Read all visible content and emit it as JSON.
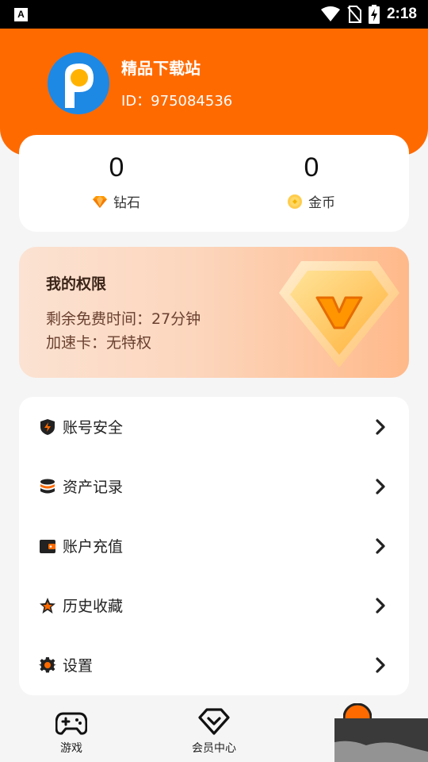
{
  "status_bar": {
    "notification_icon": "A",
    "time": "2:18",
    "icons": [
      "wifi-icon",
      "no-sim-icon",
      "battery-charging-icon"
    ]
  },
  "profile": {
    "name": "精品下载站",
    "id_text": "ID：975084536",
    "avatar_icon": "p-logo-icon",
    "header_color": "#ff6a00"
  },
  "stats": {
    "diamond": {
      "value": "0",
      "label": "钻石",
      "icon": "diamond-icon"
    },
    "gold": {
      "value": "0",
      "label": "金币",
      "icon": "gold-coin-icon"
    }
  },
  "permissions": {
    "title": "我的权限",
    "free_time": "剩余免费时间：27分钟",
    "speed_card": "加速卡：无特权",
    "badge_icon": "vip-v-shield-icon"
  },
  "menu": [
    {
      "label": "账号安全",
      "icon": "shield-bolt-icon"
    },
    {
      "label": "资产记录",
      "icon": "coin-stack-icon"
    },
    {
      "label": "账户充值",
      "icon": "wallet-icon"
    },
    {
      "label": "历史收藏",
      "icon": "star-icon"
    },
    {
      "label": "设置",
      "icon": "gear-icon"
    }
  ],
  "tabs": [
    {
      "label": "游戏",
      "icon": "gamepad-icon"
    },
    {
      "label": "会员中心",
      "icon": "vip-heart-icon"
    }
  ],
  "colors": {
    "accent": "#ff6a00",
    "background": "#f5f5f5"
  }
}
